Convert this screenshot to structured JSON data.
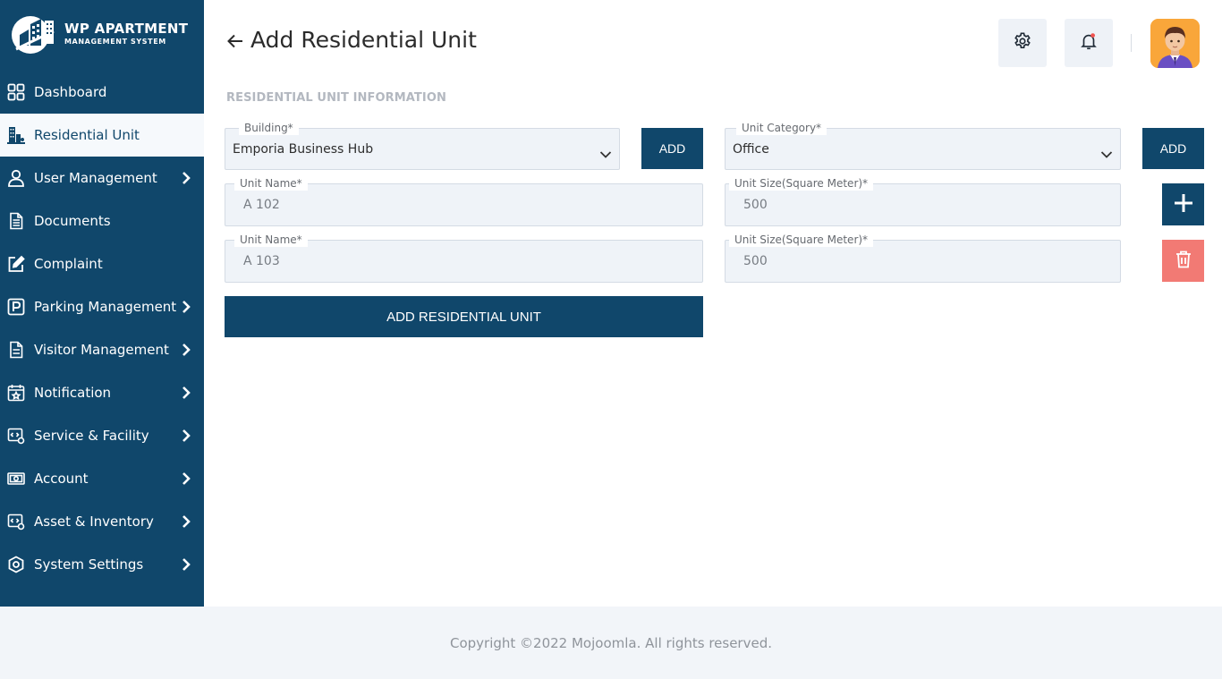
{
  "app": {
    "logo_title": "WP APARTMENT",
    "logo_subtitle": "MANAGEMENT SYSTEM"
  },
  "sidebar": {
    "items": [
      {
        "label": "Dashboard",
        "icon": "dashboard-grid-icon",
        "has_submenu": false,
        "active": false
      },
      {
        "label": "Residential Unit",
        "icon": "building-icon",
        "has_submenu": false,
        "active": true
      },
      {
        "label": "User Management",
        "icon": "user-icon",
        "has_submenu": true,
        "active": false
      },
      {
        "label": "Documents",
        "icon": "document-icon",
        "has_submenu": false,
        "active": false
      },
      {
        "label": "Complaint",
        "icon": "edit-icon",
        "has_submenu": false,
        "active": false
      },
      {
        "label": "Parking Management",
        "icon": "parking-icon",
        "has_submenu": true,
        "active": false
      },
      {
        "label": "Visitor Management",
        "icon": "clipboard-icon",
        "has_submenu": true,
        "active": false
      },
      {
        "label": "Notification",
        "icon": "calendar-star-icon",
        "has_submenu": true,
        "active": false
      },
      {
        "label": "Service & Facility",
        "icon": "service-icon",
        "has_submenu": true,
        "active": false
      },
      {
        "label": "Account",
        "icon": "money-icon",
        "has_submenu": true,
        "active": false
      },
      {
        "label": "Asset & Inventory",
        "icon": "asset-icon",
        "has_submenu": true,
        "active": false
      },
      {
        "label": "System Settings",
        "icon": "settings-icon",
        "has_submenu": true,
        "active": false
      }
    ]
  },
  "header": {
    "title": "Add Residential Unit"
  },
  "form": {
    "section_heading": "RESIDENTIAL UNIT INFORMATION",
    "building": {
      "label": "Building*",
      "value": "Emporia Business Hub"
    },
    "building_add": "ADD",
    "unit_category": {
      "label": "Unit Category*",
      "value": "Office"
    },
    "category_add": "ADD",
    "rows": [
      {
        "name_label": "Unit Name*",
        "name_value": "A 102",
        "size_label": "Unit Size(Square Meter)*",
        "size_value": "500"
      },
      {
        "name_label": "Unit Name*",
        "name_value": "A 103",
        "size_label": "Unit Size(Square Meter)*",
        "size_value": "500"
      }
    ],
    "submit_label": "ADD RESIDENTIAL UNIT"
  },
  "footer": {
    "copyright": "Copyright ©2022 Mojoomla. All rights reserved."
  },
  "colors": {
    "primary": "#10476b",
    "danger": "#f27a74",
    "field_bg": "#eff3f8",
    "notification_dot": "#f0524f",
    "avatar_bg": "#f9a63a"
  }
}
